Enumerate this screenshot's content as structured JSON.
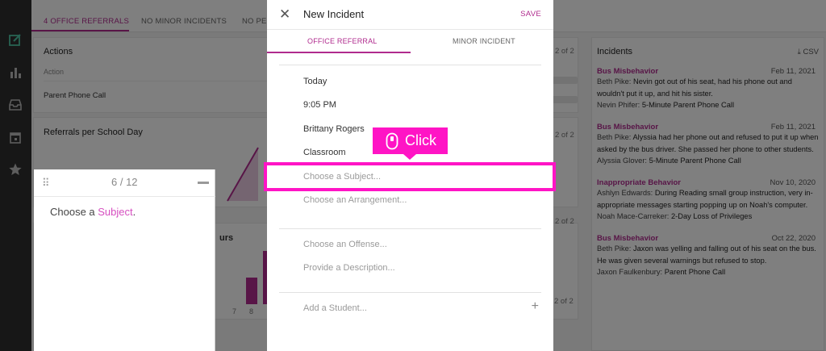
{
  "app": {
    "tabs": [
      "4 OFFICE REFERRALS",
      "NO MINOR INCIDENTS",
      "NO PEN"
    ]
  },
  "actions_card": {
    "title": "Actions",
    "col_header": "Action",
    "rows": [
      "Parent Phone Call"
    ],
    "pager": "2 of 2"
  },
  "referrals_card": {
    "title": "Referrals per School Day",
    "pager": "2 of 2"
  },
  "hours_card": {
    "title_fragment": "urs",
    "x_labels": [
      "7",
      "8"
    ],
    "pager": "2 of 2"
  },
  "pager_4": {
    "text": "2 of 2"
  },
  "incidents": {
    "title": "Incidents",
    "csv_label": "CSV",
    "items": [
      {
        "title": "Bus Misbehavior",
        "date": "Feb 11, 2021",
        "reporter": "Beth Pike:",
        "description_1": "Nevin got out of his seat, had his phone out and",
        "description_2": "wouldn't put it up, and hit his sister.",
        "student": "Nevin Phifer:",
        "action": "5-Minute Parent Phone Call"
      },
      {
        "title": "Bus Misbehavior",
        "date": "Feb 11, 2021",
        "reporter": "Beth Pike:",
        "description_1": "Alyssia had her phone out and refused to put it up when",
        "description_2": "asked by the bus driver. She passed her phone to other students.",
        "student": "Alyssia Glover:",
        "action": "5-Minute Parent Phone Call"
      },
      {
        "title": "Inappropriate Behavior",
        "date": "Nov 10, 2020",
        "reporter": "Ashlyn Edwards:",
        "description_1": "During Reading small group instruction, very in-",
        "description_2": "appropriate messages starting popping up on Noah's computer.",
        "student": "Noah Mace-Carreker:",
        "action": "2-Day Loss of Privileges"
      },
      {
        "title": "Bus Misbehavior",
        "date": "Oct 22, 2020",
        "reporter": "Beth Pike:",
        "description_1": "Jaxon was yelling and falling out of his seat on the bus.",
        "description_2": "He was given several warnings but refused to stop.",
        "student": "Jaxon Faulkenbury:",
        "action": "Parent Phone Call"
      }
    ]
  },
  "modal": {
    "title": "New Incident",
    "save_label": "SAVE",
    "tab_office": "OFFICE REFERRAL",
    "tab_minor": "MINOR INCIDENT",
    "date_value": "Today",
    "time_value": "9:05 PM",
    "reporter_value": "Brittany Rogers",
    "location_value": "Classroom",
    "subject_placeholder": "Choose a Subject...",
    "arrangement_placeholder": "Choose an Arrangement...",
    "offense_placeholder": "Choose an Offense...",
    "description_placeholder": "Provide a Description...",
    "student_placeholder": "Add a Student..."
  },
  "tutorial": {
    "step": "6 / 12",
    "text_prefix": "Choose a ",
    "text_highlight": "Subject",
    "text_suffix": ".",
    "click_label": "Click"
  },
  "colors": {
    "accent": "#b02b8e",
    "highlight": "#ff14c5",
    "sidebar": "#2f2f2f",
    "sidebar_icon_active": "#4fc7a6"
  }
}
